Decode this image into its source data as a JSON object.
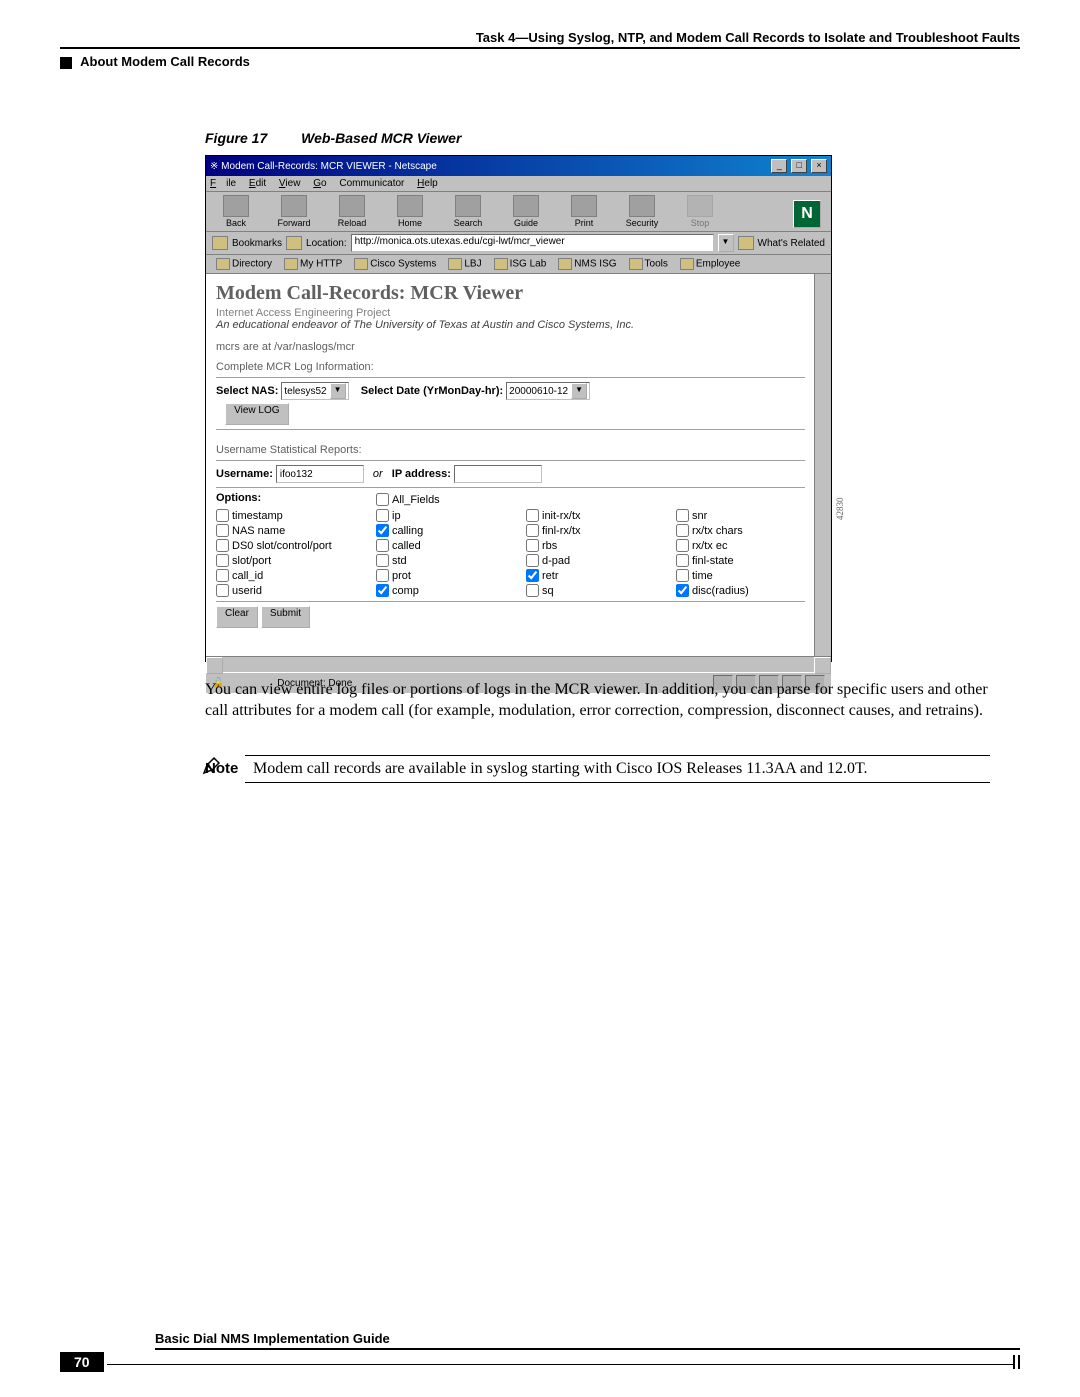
{
  "header": {
    "task_line": "Task 4—Using Syslog, NTP, and Modem Call Records to Isolate and Troubleshoot Faults",
    "section": "About Modem Call Records"
  },
  "figure": {
    "num": "Figure 17",
    "title": "Web-Based MCR Viewer",
    "side_id": "42830"
  },
  "win": {
    "title": "Modem Call-Records: MCR VIEWER - Netscape",
    "menu": {
      "file": "File",
      "edit": "Edit",
      "view": "View",
      "go": "Go",
      "comm": "Communicator",
      "help": "Help"
    },
    "tb": {
      "back": "Back",
      "forward": "Forward",
      "reload": "Reload",
      "home": "Home",
      "search": "Search",
      "guide": "Guide",
      "print": "Print",
      "security": "Security",
      "stop": "Stop"
    },
    "loc": {
      "bookmarks": "Bookmarks",
      "label": "Location:",
      "url": "http://monica.ots.utexas.edu/cgi-lwt/mcr_viewer",
      "whats": "What's Related"
    },
    "links": {
      "dir": "Directory",
      "myhttp": "My HTTP",
      "cisco": "Cisco Systems",
      "lbj": "LBJ",
      "isglab": "ISG Lab",
      "nms": "NMS ISG",
      "tools": "Tools",
      "emp": "Employee"
    }
  },
  "content": {
    "h1": "Modem Call-Records: MCR Viewer",
    "sub1": "Internet Access Engineering Project",
    "sub2": "An educational endeavor of The University of Texas at Austin and Cisco Systems, Inc.",
    "path": "mcrs are at /var/naslogs/mcr",
    "sect1": "Complete MCR Log Information:",
    "nas_label": "Select NAS:",
    "nas_val": "telesys52",
    "date_label": "Select Date (YrMonDay-hr):",
    "date_val": "20000610-12",
    "viewlog": "View LOG",
    "sect2": "Username Statistical Reports:",
    "user_label": "Username:",
    "user_val": "ifoo132",
    "or": "or",
    "ip_label": "IP address:",
    "ip_val": "",
    "opts_label": "Options:",
    "all": "All_Fields",
    "c1": [
      "timestamp",
      "NAS name",
      "DS0 slot/control/port",
      "slot/port",
      "call_id",
      "userid"
    ],
    "c2": [
      "ip",
      "calling",
      "called",
      "std",
      "prot",
      "comp"
    ],
    "c2_checked": [
      false,
      true,
      false,
      false,
      false,
      true
    ],
    "c3": [
      "init-rx/tx",
      "finl-rx/tx",
      "rbs",
      "d-pad",
      "retr",
      "sq"
    ],
    "c3_checked": [
      false,
      false,
      false,
      false,
      true,
      false
    ],
    "c4": [
      "snr",
      "rx/tx chars",
      "rx/tx ec",
      "finl-state",
      "time",
      "disc(radius)"
    ],
    "c4_checked": [
      false,
      false,
      false,
      false,
      false,
      true
    ],
    "clear": "Clear",
    "submit": "Submit"
  },
  "status": {
    "doc": "Document: Done"
  },
  "body_text": "You can view entire log files or portions of logs in the MCR viewer. In addition, you can parse for specific users and other call attributes for a modem call (for example, modulation, error correction, compression, disconnect causes, and retrains).",
  "note": {
    "label": "Note",
    "text": "Modem call records are available in syslog starting with Cisco IOS Releases 11.3AA and 12.0T."
  },
  "footer": {
    "title": "Basic Dial NMS Implementation Guide",
    "page": "70"
  }
}
